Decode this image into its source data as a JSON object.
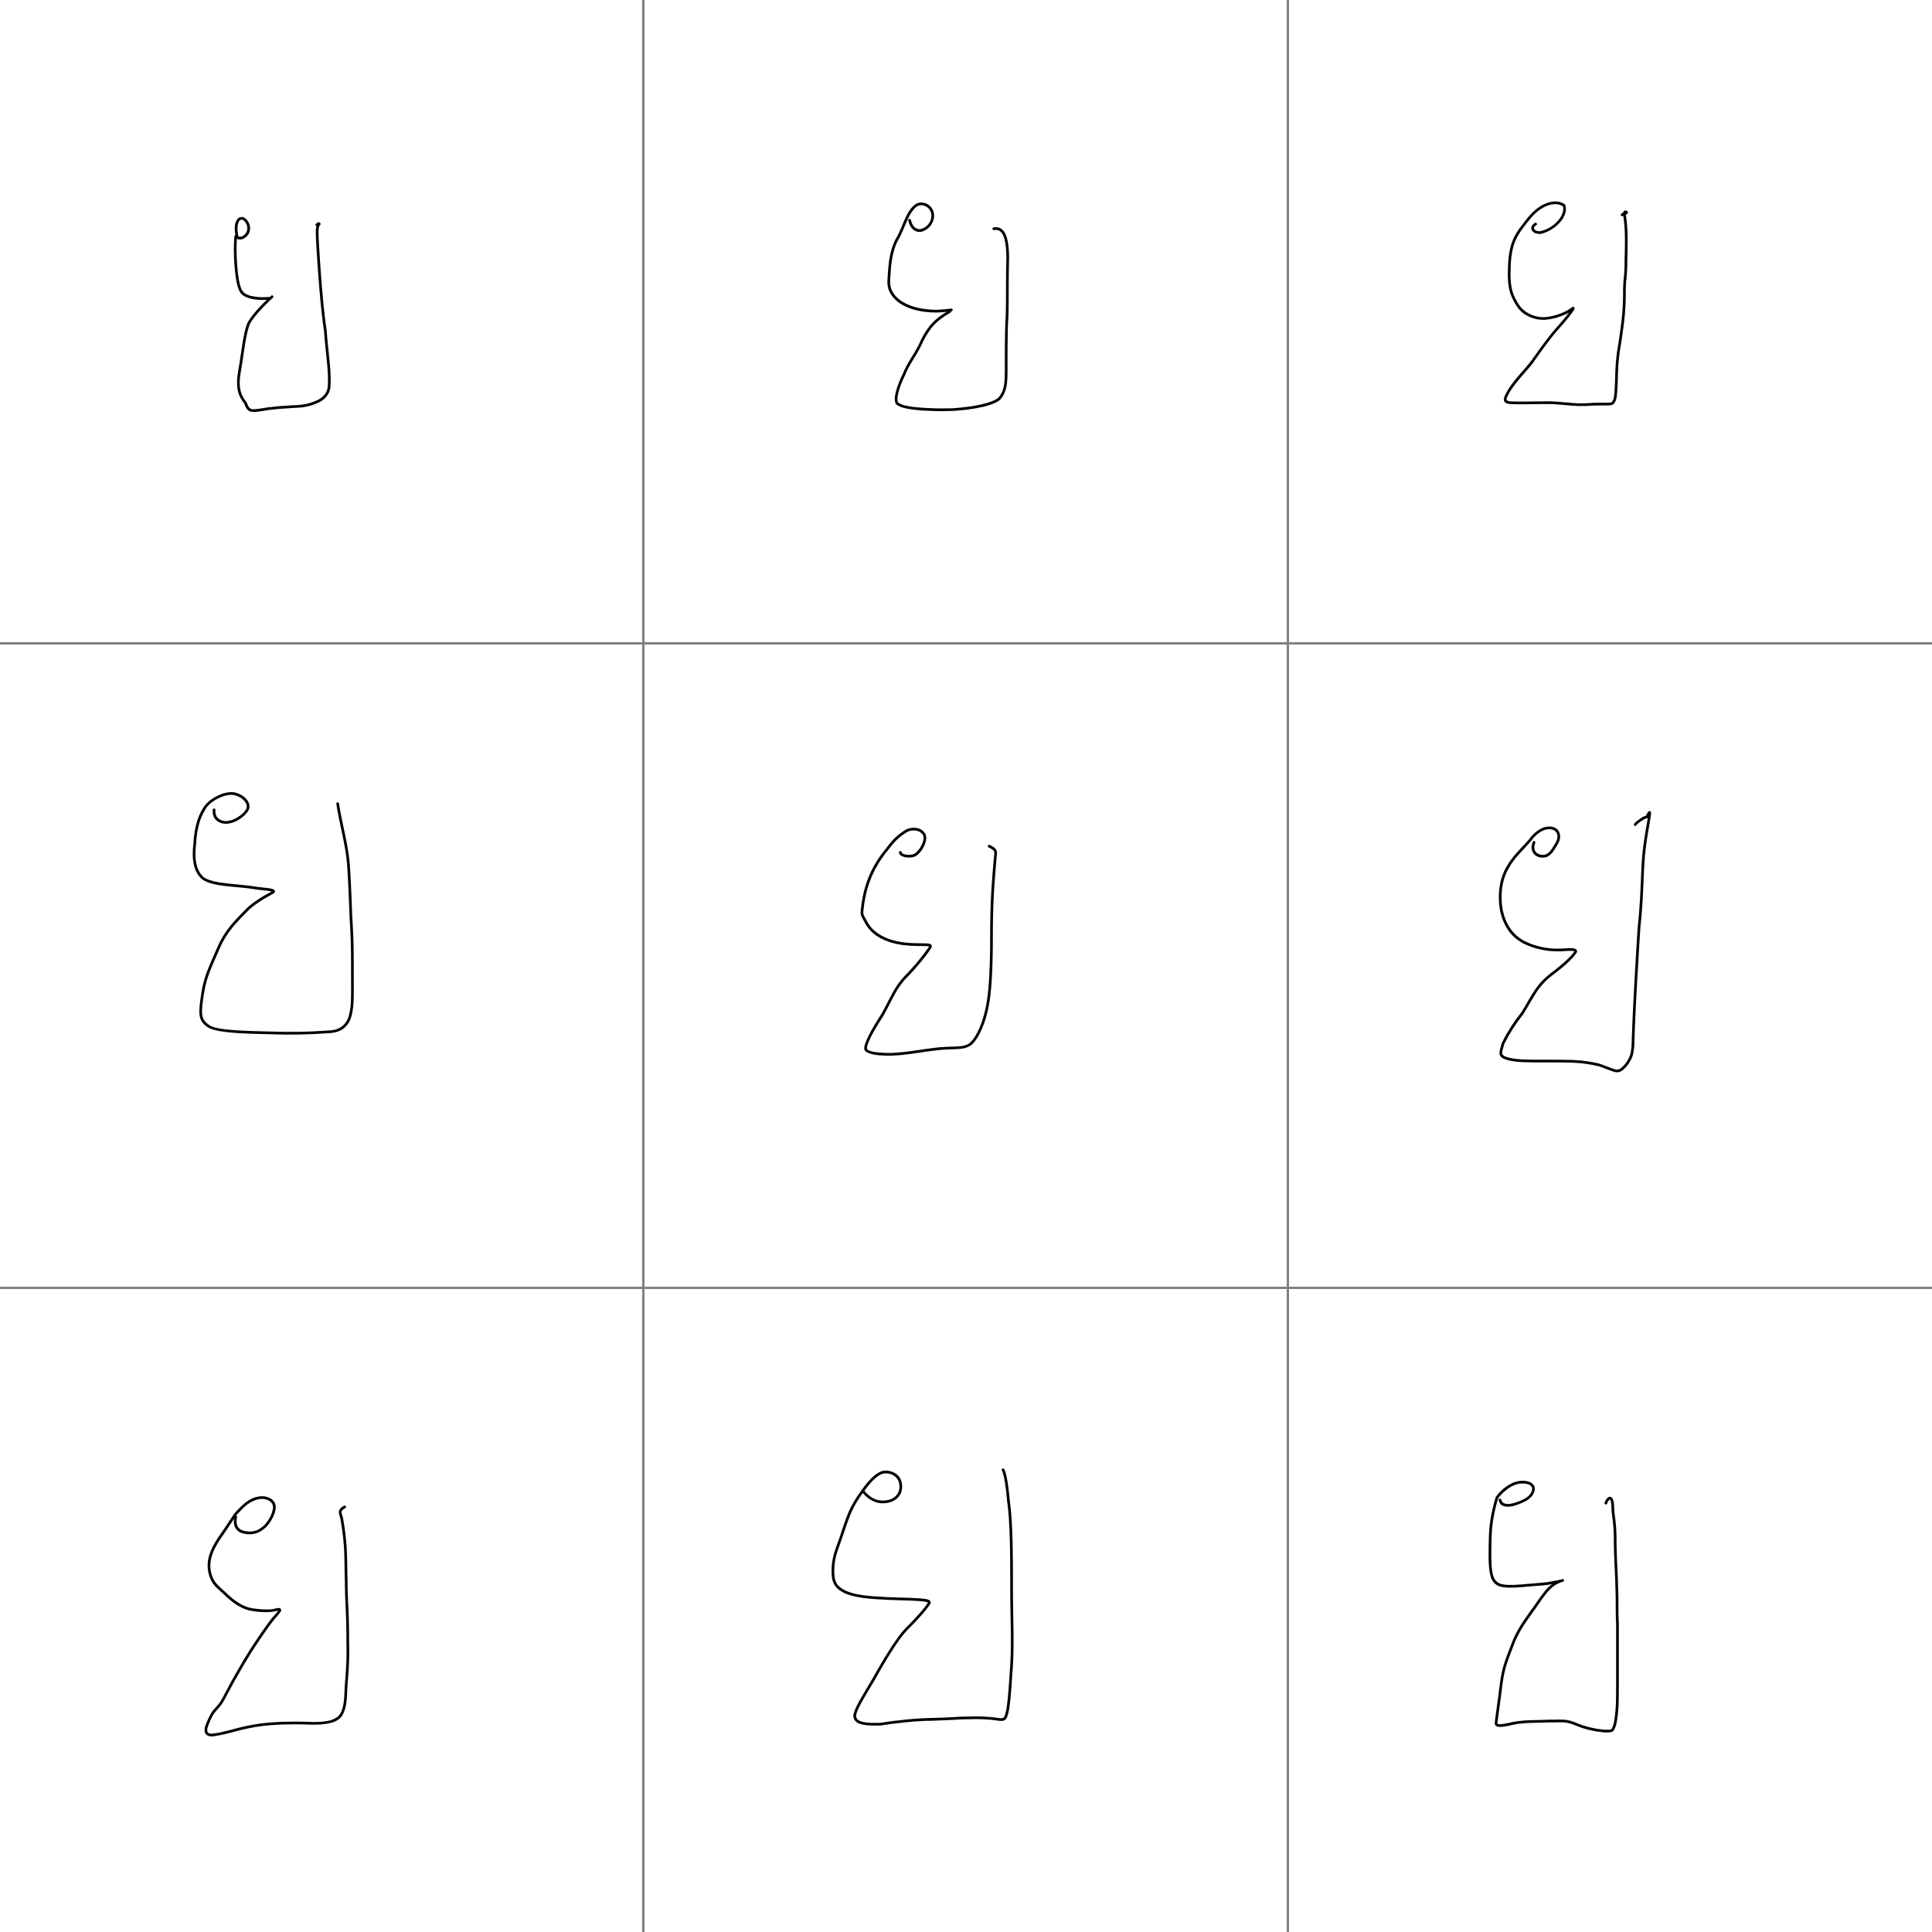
{
  "grid": {
    "rows": 3,
    "columns": 3,
    "divider_color": "#808080",
    "background_color": "#ffffff",
    "stroke_color": "#000000"
  },
  "cells": [
    {
      "row": 1,
      "column": 1,
      "content": "handwritten-glyph"
    },
    {
      "row": 1,
      "column": 2,
      "content": "handwritten-glyph"
    },
    {
      "row": 1,
      "column": 3,
      "content": "handwritten-glyph"
    },
    {
      "row": 2,
      "column": 1,
      "content": "handwritten-glyph"
    },
    {
      "row": 2,
      "column": 2,
      "content": "handwritten-glyph"
    },
    {
      "row": 2,
      "column": 3,
      "content": "handwritten-glyph"
    },
    {
      "row": 3,
      "column": 1,
      "content": "handwritten-glyph"
    },
    {
      "row": 3,
      "column": 2,
      "content": "handwritten-glyph"
    },
    {
      "row": 3,
      "column": 3,
      "content": "handwritten-glyph"
    }
  ]
}
